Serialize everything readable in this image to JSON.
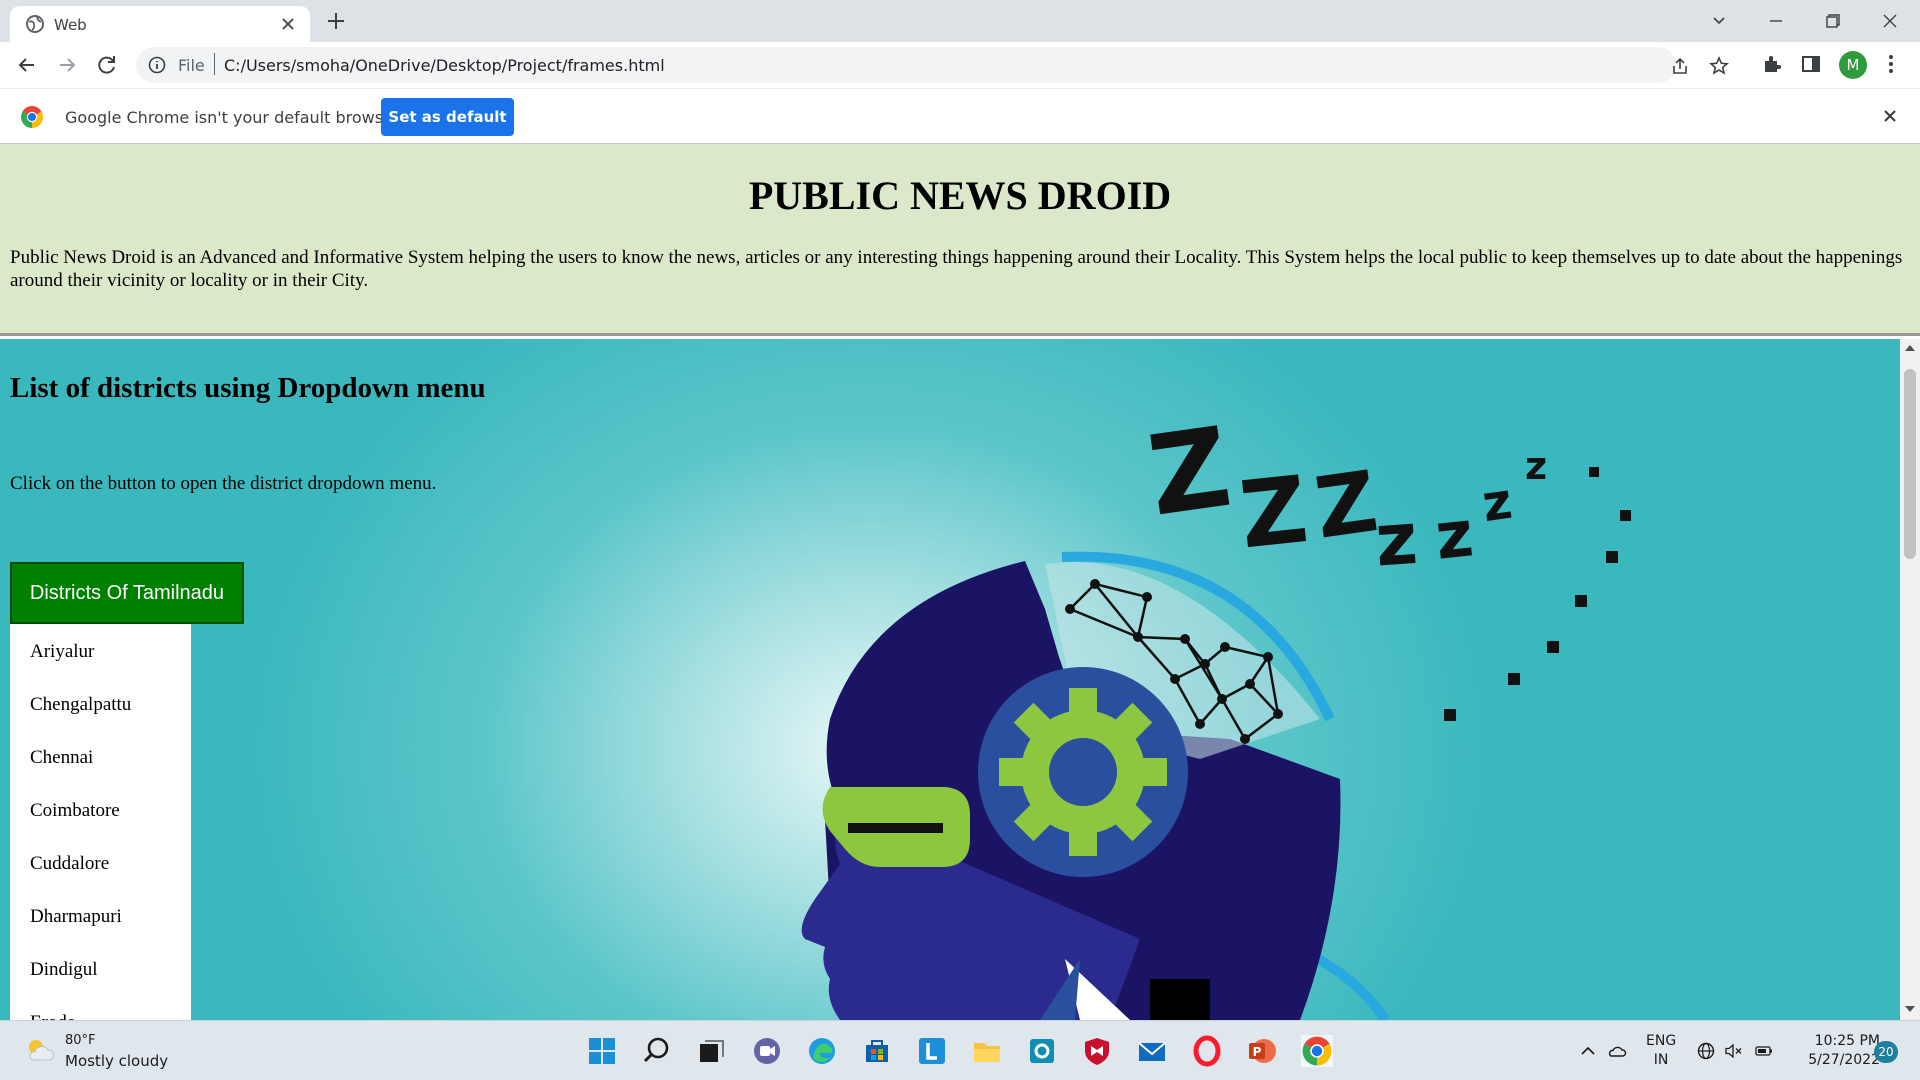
{
  "browser": {
    "tab_title": "Web",
    "url_scheme": "File",
    "url": "C:/Users/smoha/OneDrive/Desktop/Project/frames.html",
    "profile_initial": "M",
    "infobar_message": "Google Chrome isn't your default browser",
    "set_default_label": "Set as default"
  },
  "top_frame": {
    "title": "PUBLIC NEWS DROID",
    "description": "Public News Droid is an Advanced and Informative System helping the users to know the news, articles or any interesting things happening around their Locality. This System helps the local public to keep themselves up to date about the happenings around their vicinity or locality or in their City."
  },
  "bottom_frame": {
    "heading": "List of districts using Dropdown menu",
    "instruction": "Click on the button to open the district dropdown menu.",
    "dropdown_button": "Districts Of Tamilnadu",
    "districts": [
      "Ariyalur",
      "Chengalpattu",
      "Chennai",
      "Coimbatore",
      "Cuddalore",
      "Dharmapuri",
      "Dindigul",
      "Erode"
    ],
    "background_art": "sleeping robot head with gear",
    "art_text": "ZZZZzzzz"
  },
  "taskbar": {
    "weather_temp": "80°F",
    "weather_condition": "Mostly cloudy",
    "language": "ENG",
    "region": "IN",
    "time": "10:25 PM",
    "date": "5/27/2022",
    "notification_count": "20",
    "apps": [
      "start",
      "search",
      "task-view",
      "teams",
      "edge",
      "store",
      "l-app",
      "file-explorer",
      "app-square",
      "mcafee",
      "mail",
      "opera",
      "powerpoint",
      "chrome"
    ]
  },
  "colors": {
    "top_frame_bg": "#dbe8c9",
    "bottom_frame_bg": "#3bb8be",
    "dropdown_button_bg": "#008000",
    "set_default_bg": "#1a73e8",
    "robot_dark": "#1b1464",
    "gear_green": "#8dc63f"
  }
}
